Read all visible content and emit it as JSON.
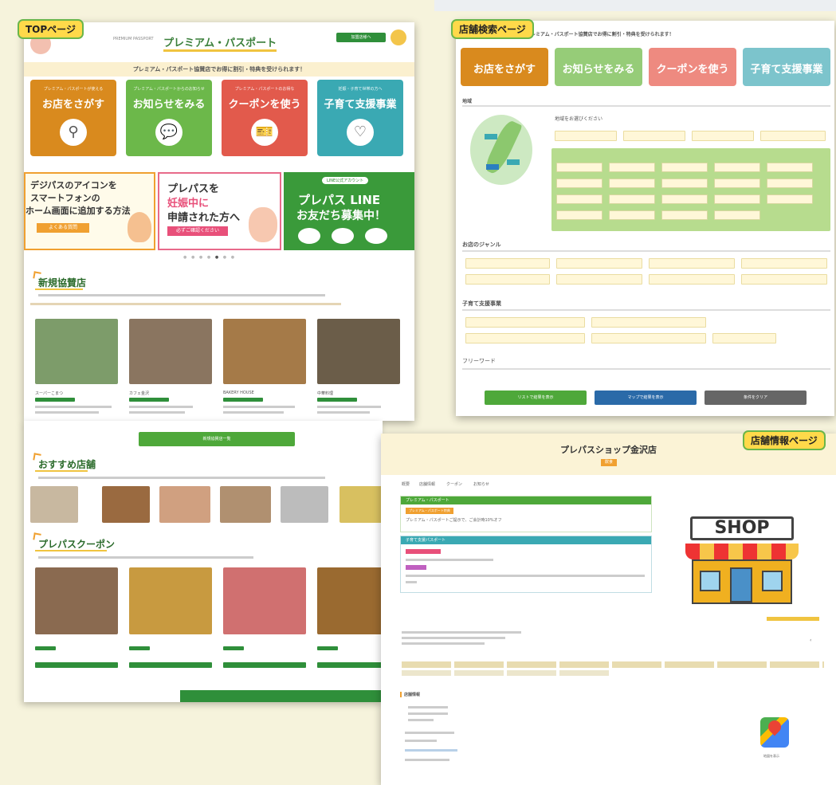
{
  "tags": {
    "top": "TOPページ",
    "search": "店舗検索ページ",
    "info": "店舗情報ページ"
  },
  "top": {
    "logo_small": "PREMIUM PASSPORT",
    "logo_text": "プレミアム・パスポート",
    "header_btn": "加盟店様へ",
    "tagline": "プレミアム・パスポート協賛店でお得に割引・特典を受けられます！",
    "cards": [
      {
        "sub": "プレミアム・パスポートが使える",
        "label": "お店をさがす",
        "color": "#d98a1e",
        "icon": "magnifier-icon"
      },
      {
        "sub": "プレミアム・パスポートからのお知らせ",
        "label": "お知らせをみる",
        "color": "#6cb84a",
        "icon": "chat-icon"
      },
      {
        "sub": "プレミアム・パスポートのお得な",
        "label": "クーポンを使う",
        "color": "#e25a4c",
        "icon": "ticket-icon"
      },
      {
        "sub": "妊娠・子育て世帯の方へ",
        "label": "子育て支援事業",
        "color": "#3aa9b3",
        "icon": "heart-hand-icon"
      }
    ],
    "banner1": {
      "l1": "デジパスのアイコンを",
      "l2": "スマートフォンの",
      "l3": "ホーム画面に追加する方法",
      "btn": "よくある質問"
    },
    "banner2": {
      "l1": "プレパスを",
      "l2": "妊娠中に",
      "l3": "申請された方へ",
      "btn": "必ずご確認ください"
    },
    "banner3": {
      "badge": "LINE公式アカウント",
      "l1": "プレパス LINE",
      "l2": "お友だち募集中！"
    },
    "sec1": {
      "title": "新規協賛店",
      "btn": "新規協賛店一覧"
    },
    "shops": [
      {
        "name": "スーパーこまつ",
        "photo": "#7d9c6a"
      },
      {
        "name": "カフェ金沢",
        "photo": "#8a7560"
      },
      {
        "name": "BAKERY HOUSE",
        "photo": "#a57a48"
      },
      {
        "name": "中華料理",
        "photo": "#6b5d49"
      }
    ],
    "sec2": {
      "title": "おすすめ店舗"
    },
    "rec": [
      "#c8b8a0",
      "#9a6a40",
      "#d0a080",
      "#b09070",
      "#bcbcbc",
      "#d8c060"
    ],
    "sec3": {
      "title": "プレパスクーポン"
    },
    "coupons": [
      "#8a6a50",
      "#c89a40",
      "#d07070",
      "#9a6a30"
    ]
  },
  "search": {
    "tagline": "プレミアム・パスポート協賛店でお得に割引・特典を受けられます！",
    "tabs": [
      {
        "label": "お店をさがす",
        "color": "#d98a1e"
      },
      {
        "label": "お知らせをみる",
        "color": "#96cc78"
      },
      {
        "label": "クーポンを使う",
        "color": "#ee8a80"
      },
      {
        "label": "子育て支援事業",
        "color": "#7cc4cc"
      }
    ],
    "area_label": "地域",
    "area_prompt": "地域をお選びください",
    "genre_label": "お店のジャンル",
    "support_label": "子育て支援事業",
    "keyword_label": "フリーワード",
    "btn_list": "リストで結果を表示",
    "btn_map": "マップで結果を表示",
    "btn_clear": "条件をクリア"
  },
  "info": {
    "title": "プレパスショップ金沢店",
    "badge": "飲食",
    "tabs": [
      "概要",
      "店舗情報",
      "クーポン",
      "お知らせ"
    ],
    "box1_head": "プレミアム・パスポート",
    "box1_tag": "プレミアム・パスポート特典",
    "box1_text": "プレミアム・パスポートご提示で、ご会計時10%オフ",
    "box2_head": "子育て支援パスポート",
    "sign": "SHOP",
    "info_head": "店舗情報",
    "map_label": "地図を表示"
  },
  "colors": {
    "green": "#2f8f3a",
    "yellow": "#ffd94a",
    "orange": "#d98a1e"
  }
}
